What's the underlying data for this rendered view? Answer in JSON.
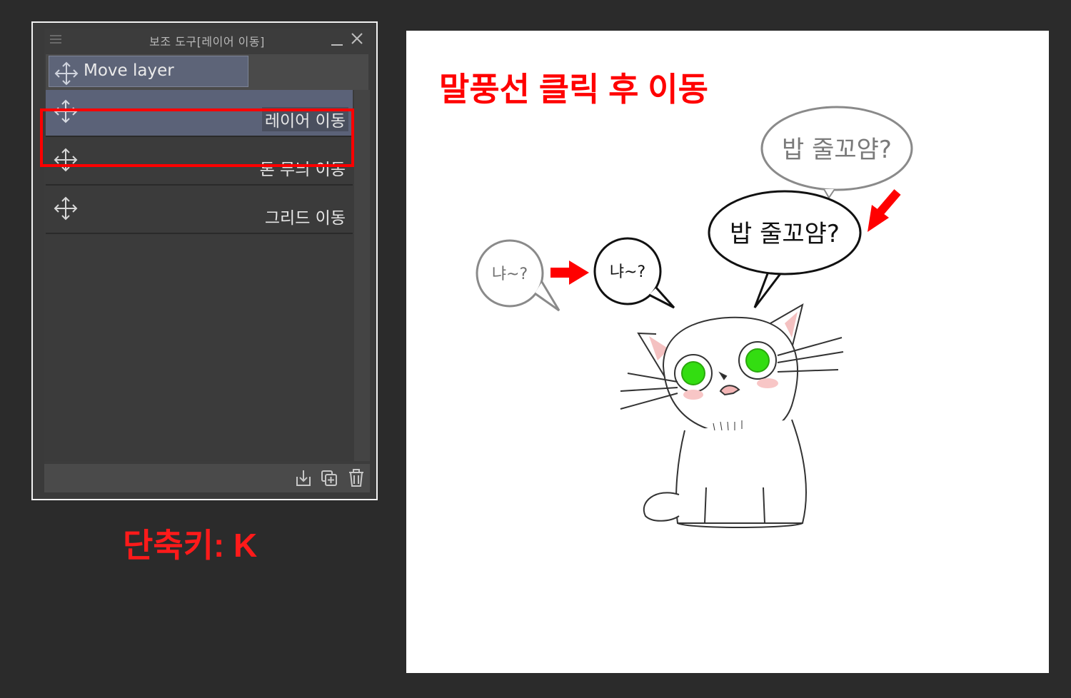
{
  "panel": {
    "title": "보조 도구[레이어 이동]",
    "tab_active_label": "Move layer",
    "items": [
      {
        "label": "레이어 이동",
        "icon": "move-arrows-icon"
      },
      {
        "label": "톤 무늬 이동",
        "icon": "move-arrows-icon"
      },
      {
        "label": "그리드 이동",
        "icon": "move-arrows-icon"
      }
    ],
    "footer_icons": [
      "import-icon",
      "duplicate-icon",
      "trash-icon"
    ]
  },
  "shortcut": {
    "text": "단축키: K"
  },
  "canvas": {
    "caption": "말풍선 클릭 후 이동",
    "bubbles": {
      "small_ghost": "냐~?",
      "small_solid": "냐~?",
      "large_ghost": "밥 줄꼬얌?",
      "large_solid": "밥 줄꼬얌?"
    }
  },
  "colors": {
    "accent_red": "#ff0000",
    "panel_selected": "#5b6278"
  }
}
